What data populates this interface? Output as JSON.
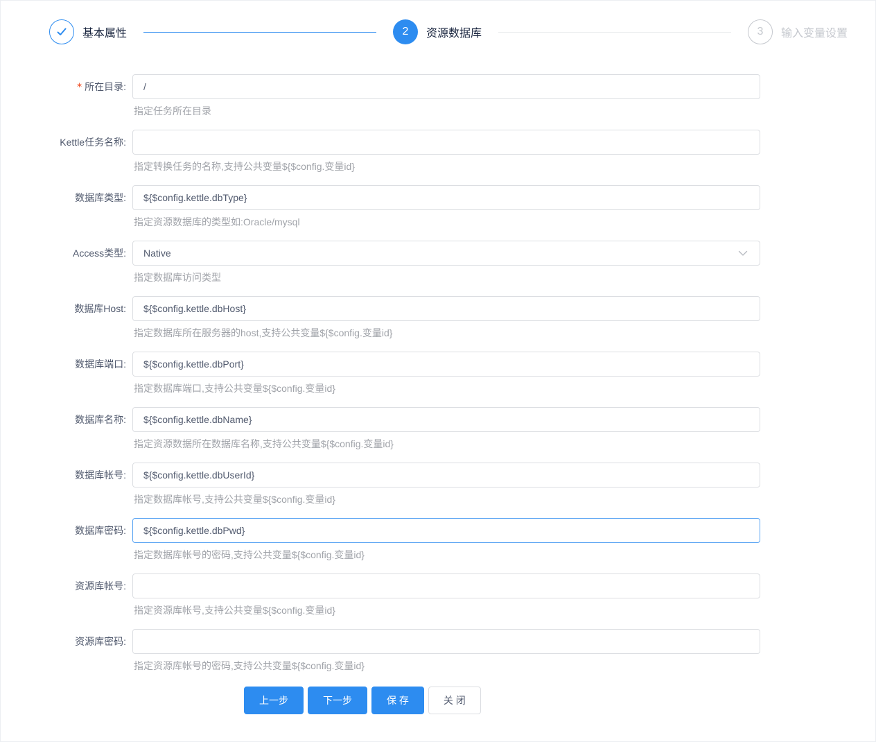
{
  "colors": {
    "primary": "#2d8cf0",
    "focus_border": "#57a3f3",
    "waiting_gray": "#c5c8ce",
    "required_red": "#ed4014"
  },
  "steps": [
    {
      "id": "basic",
      "status": "finished",
      "icon": "check-icon",
      "number": "",
      "label": "基本属性",
      "connector": "blue"
    },
    {
      "id": "resource",
      "status": "current",
      "icon": "",
      "number": "2",
      "label": "资源数据库",
      "connector": "gray"
    },
    {
      "id": "variables",
      "status": "waiting",
      "icon": "",
      "number": "3",
      "label": "输入变量设置",
      "connector": ""
    }
  ],
  "form": {
    "fields": [
      {
        "name": "directory",
        "label": "所在目录:",
        "required": true,
        "type": "text",
        "value": "/",
        "hint": "指定任务所在目录"
      },
      {
        "name": "kettle-task-name",
        "label": "Kettle任务名称:",
        "required": false,
        "type": "text",
        "value": "",
        "hint": "指定转换任务的名称,支持公共变量${$config.变量id}"
      },
      {
        "name": "db-type",
        "label": "数据库类型:",
        "required": false,
        "type": "text",
        "value": "${$config.kettle.dbType}",
        "hint": "指定资源数据库的类型如:Oracle/mysql"
      },
      {
        "name": "access-type",
        "label": "Access类型:",
        "required": false,
        "type": "select",
        "value": "Native",
        "hint": "指定数据库访问类型"
      },
      {
        "name": "db-host",
        "label": "数据库Host:",
        "required": false,
        "type": "text",
        "value": "${$config.kettle.dbHost}",
        "hint": "指定数据库所在服务器的host,支持公共变量${$config.变量id}"
      },
      {
        "name": "db-port",
        "label": "数据库端口:",
        "required": false,
        "type": "text",
        "value": "${$config.kettle.dbPort}",
        "hint": "指定数据库端口,支持公共变量${$config.变量id}"
      },
      {
        "name": "db-name",
        "label": "数据库名称:",
        "required": false,
        "type": "text",
        "value": "${$config.kettle.dbName}",
        "hint": "指定资源数据所在数据库名称,支持公共变量${$config.变量id}"
      },
      {
        "name": "db-user",
        "label": "数据库帐号:",
        "required": false,
        "type": "text",
        "value": "${$config.kettle.dbUserId}",
        "hint": "指定数据库帐号,支持公共变量${$config.变量id}"
      },
      {
        "name": "db-password",
        "label": "数据库密码:",
        "required": false,
        "type": "text",
        "value": "${$config.kettle.dbPwd}",
        "hint": "指定数据库帐号的密码,支持公共变量${$config.变量id}",
        "focused": true
      },
      {
        "name": "repo-user",
        "label": "资源库帐号:",
        "required": false,
        "type": "text",
        "value": "",
        "hint": "指定资源库帐号,支持公共变量${$config.变量id}"
      },
      {
        "name": "repo-password",
        "label": "资源库密码:",
        "required": false,
        "type": "text",
        "value": "",
        "hint": "指定资源库帐号的密码,支持公共变量${$config.变量id}"
      }
    ]
  },
  "footer": {
    "buttons": [
      {
        "name": "prev-step-button",
        "label": "上一步",
        "style": "primary"
      },
      {
        "name": "next-step-button",
        "label": "下一步",
        "style": "primary"
      },
      {
        "name": "save-button",
        "label": "保 存",
        "style": "primary"
      },
      {
        "name": "close-button",
        "label": "关 闭",
        "style": "default"
      }
    ]
  }
}
